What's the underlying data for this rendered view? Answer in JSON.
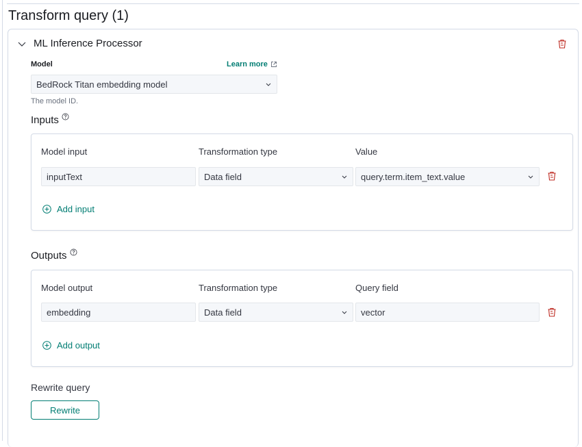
{
  "page": {
    "title": "Transform query (1)"
  },
  "processor": {
    "title": "ML Inference Processor",
    "model": {
      "label": "Model",
      "learn_more": "Learn more",
      "selected": "BedRock Titan embedding model",
      "help": "The model ID."
    },
    "inputs": {
      "title": "Inputs",
      "columns": [
        "Model input",
        "Transformation type",
        "Value"
      ],
      "rows": [
        {
          "model_input": "inputText",
          "transformation_type": "Data field",
          "value": "query.term.item_text.value"
        }
      ],
      "add_label": "Add input"
    },
    "outputs": {
      "title": "Outputs",
      "columns": [
        "Model output",
        "Transformation type",
        "Query field"
      ],
      "rows": [
        {
          "model_output": "embedding",
          "transformation_type": "Data field",
          "query_field": "vector"
        }
      ],
      "add_label": "Add output"
    },
    "rewrite": {
      "title": "Rewrite query",
      "button": "Rewrite"
    }
  },
  "colors": {
    "accent": "#017d73",
    "danger": "#bd271e",
    "field_bg": "#f5f7fa",
    "border": "#d3dae6"
  }
}
